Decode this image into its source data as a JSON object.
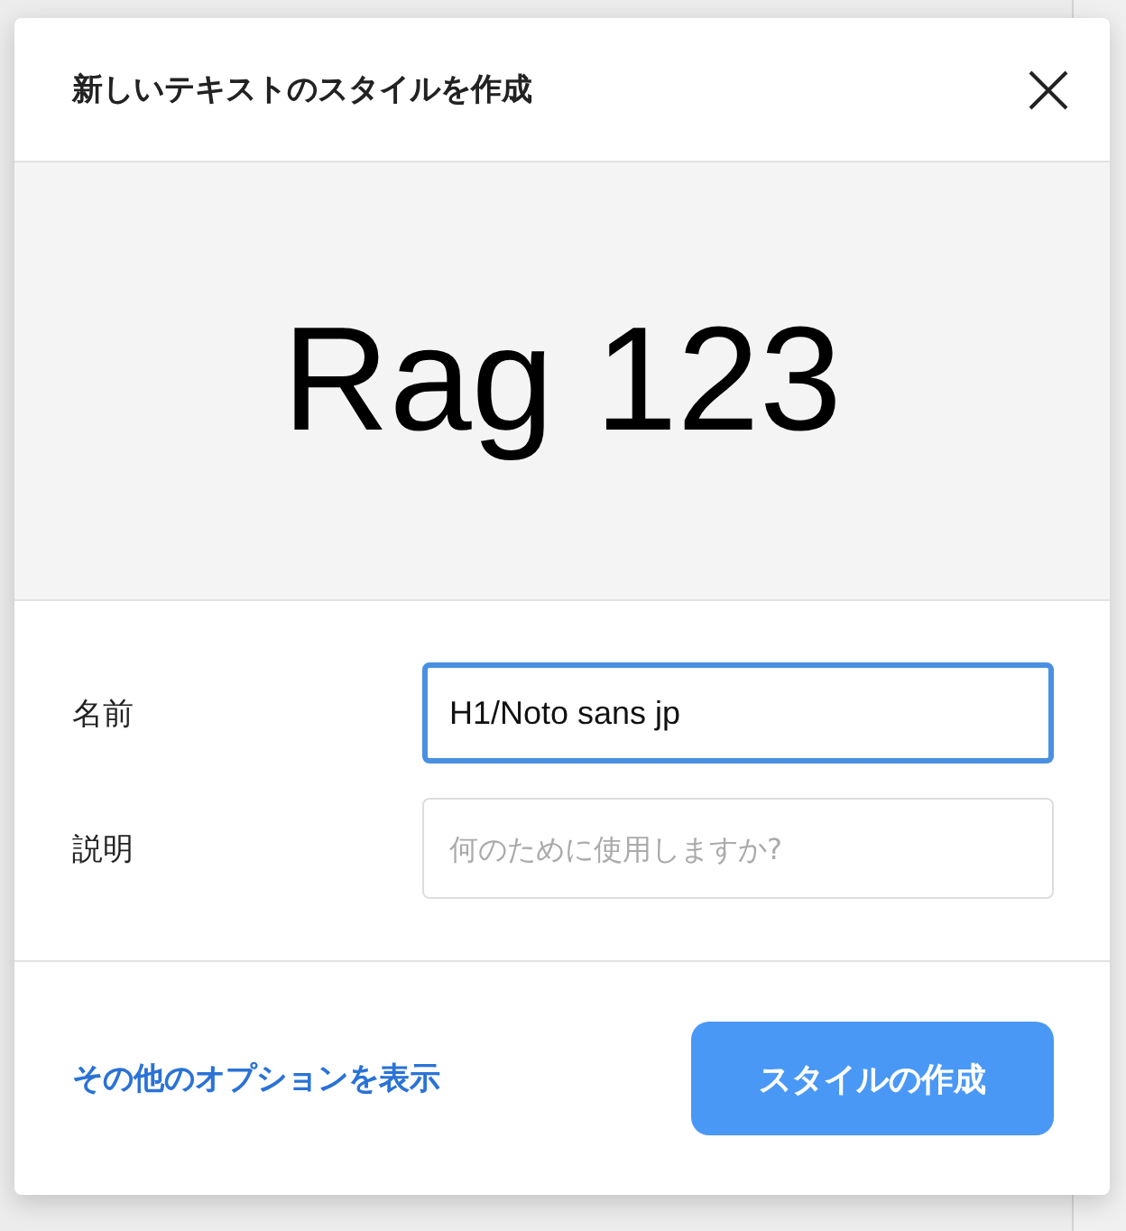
{
  "dialog": {
    "title": "新しいテキストのスタイルを作成"
  },
  "preview": {
    "text": "Rag 123"
  },
  "fields": [
    {
      "label": "名前",
      "value": "H1/Noto sans jp",
      "focused": true
    },
    {
      "label": "説明",
      "placeholder": "何のために使用しますか?",
      "focused": false
    }
  ],
  "footer": {
    "link": "その他のオプションを表示",
    "button": "スタイルの作成"
  }
}
